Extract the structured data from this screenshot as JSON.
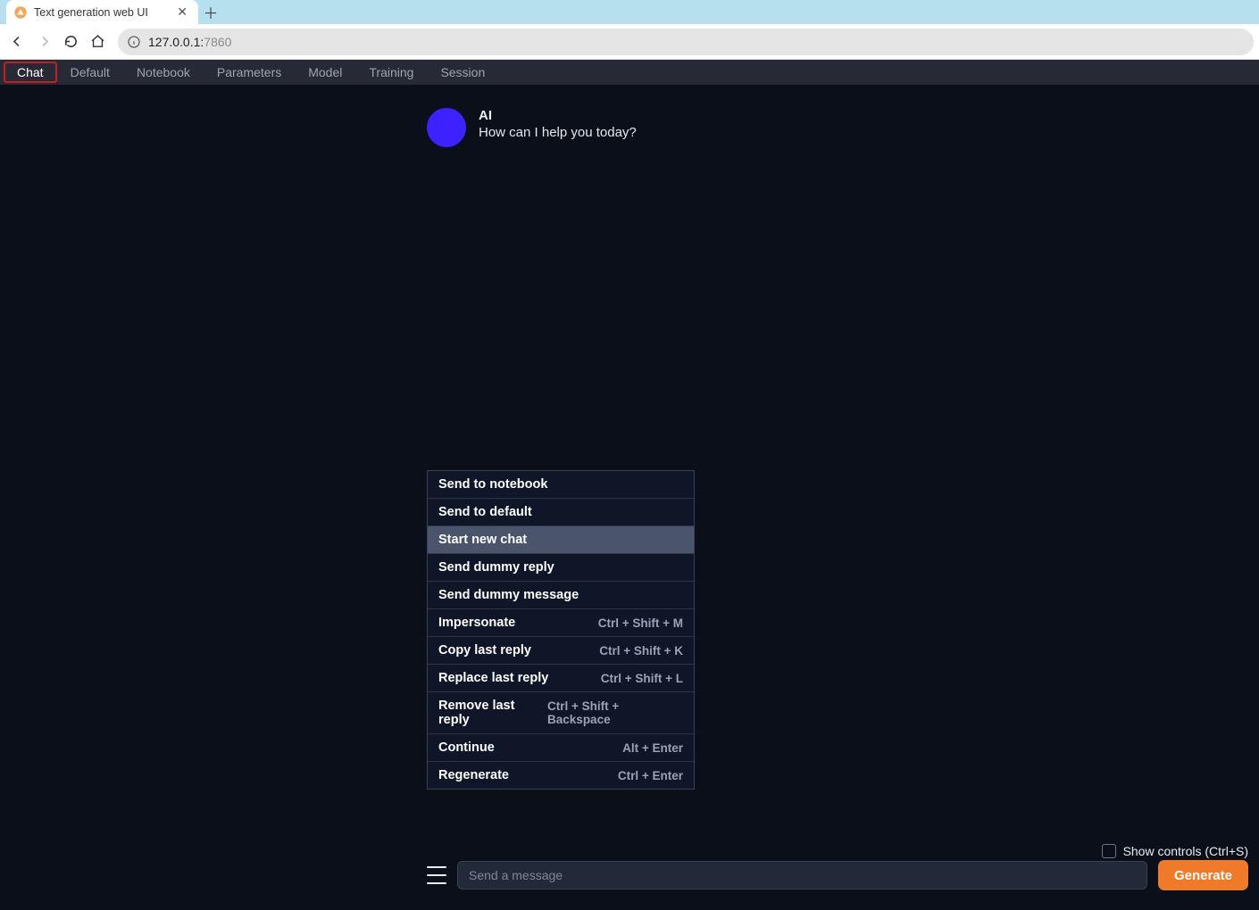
{
  "browser": {
    "tab_title": "Text generation web UI",
    "url_host": "127.0.0.1:",
    "url_port": "7860"
  },
  "app_tabs": [
    "Chat",
    "Default",
    "Notebook",
    "Parameters",
    "Model",
    "Training",
    "Session"
  ],
  "app_active_tab_index": 0,
  "chat": {
    "ai_name": "AI",
    "ai_greeting": "How can I help you today?"
  },
  "context_menu": {
    "items": [
      {
        "label": "Send to notebook",
        "shortcut": ""
      },
      {
        "label": "Send to default",
        "shortcut": ""
      },
      {
        "label": "Start new chat",
        "shortcut": "",
        "hover": true
      },
      {
        "label": "Send dummy reply",
        "shortcut": ""
      },
      {
        "label": "Send dummy message",
        "shortcut": ""
      },
      {
        "label": "Impersonate",
        "shortcut": "Ctrl + Shift + M"
      },
      {
        "label": "Copy last reply",
        "shortcut": "Ctrl + Shift + K"
      },
      {
        "label": "Replace last reply",
        "shortcut": "Ctrl + Shift + L"
      },
      {
        "label": "Remove last reply",
        "shortcut": "Ctrl + Shift + Backspace"
      },
      {
        "label": "Continue",
        "shortcut": "Alt + Enter"
      },
      {
        "label": "Regenerate",
        "shortcut": "Ctrl + Enter"
      }
    ]
  },
  "controls": {
    "show_controls_label": "Show controls (Ctrl+S)",
    "input_placeholder": "Send a message",
    "generate_label": "Generate"
  }
}
